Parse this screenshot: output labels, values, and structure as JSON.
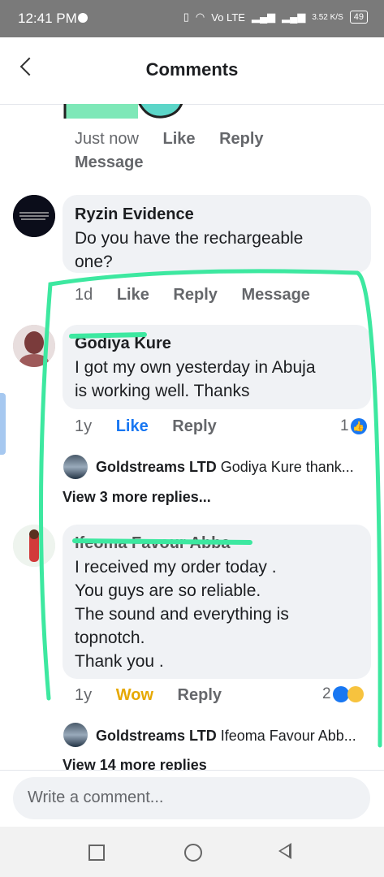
{
  "status": {
    "time": "12:41 PM",
    "network": "Vo LTE",
    "speed": "3.52 K/S",
    "battery": "49"
  },
  "header": {
    "title": "Comments"
  },
  "top_comment": {
    "time": "Just now",
    "like": "Like",
    "reply": "Reply",
    "message": "Message"
  },
  "comments": [
    {
      "author": "Ryzin Evidence",
      "lines": [
        "Do you have the rechargeable",
        "one?"
      ],
      "time": "1d",
      "like": "Like",
      "reply": "Reply",
      "message": "Message"
    },
    {
      "author": "Godiya Kure",
      "lines": [
        "I got my own yesterday in Abuja",
        "is working well. Thanks"
      ],
      "time": "1y",
      "like": "Like",
      "reply": "Reply",
      "reactions": "1",
      "reply_author": "Goldstreams LTD",
      "reply_preview": "Godiya Kure thank...",
      "view_more": "View 3 more replies..."
    },
    {
      "author": "Ifeoma Favour Abba",
      "lines": [
        "I received my order today .",
        "You guys are so reliable.",
        "The sound and everything is",
        "topnotch.",
        "Thank you ."
      ],
      "time": "1y",
      "like": "Wow",
      "reply": "Reply",
      "reactions": "2",
      "reply_author": "Goldstreams LTD",
      "reply_preview": "Ifeoma Favour Abb...",
      "view_more": "View 14 more replies"
    }
  ],
  "composer": {
    "placeholder": "Write a comment..."
  },
  "colors": {
    "like_active": "#1877f2",
    "wow": "#e6a800",
    "highlight": "#3de8a0"
  }
}
